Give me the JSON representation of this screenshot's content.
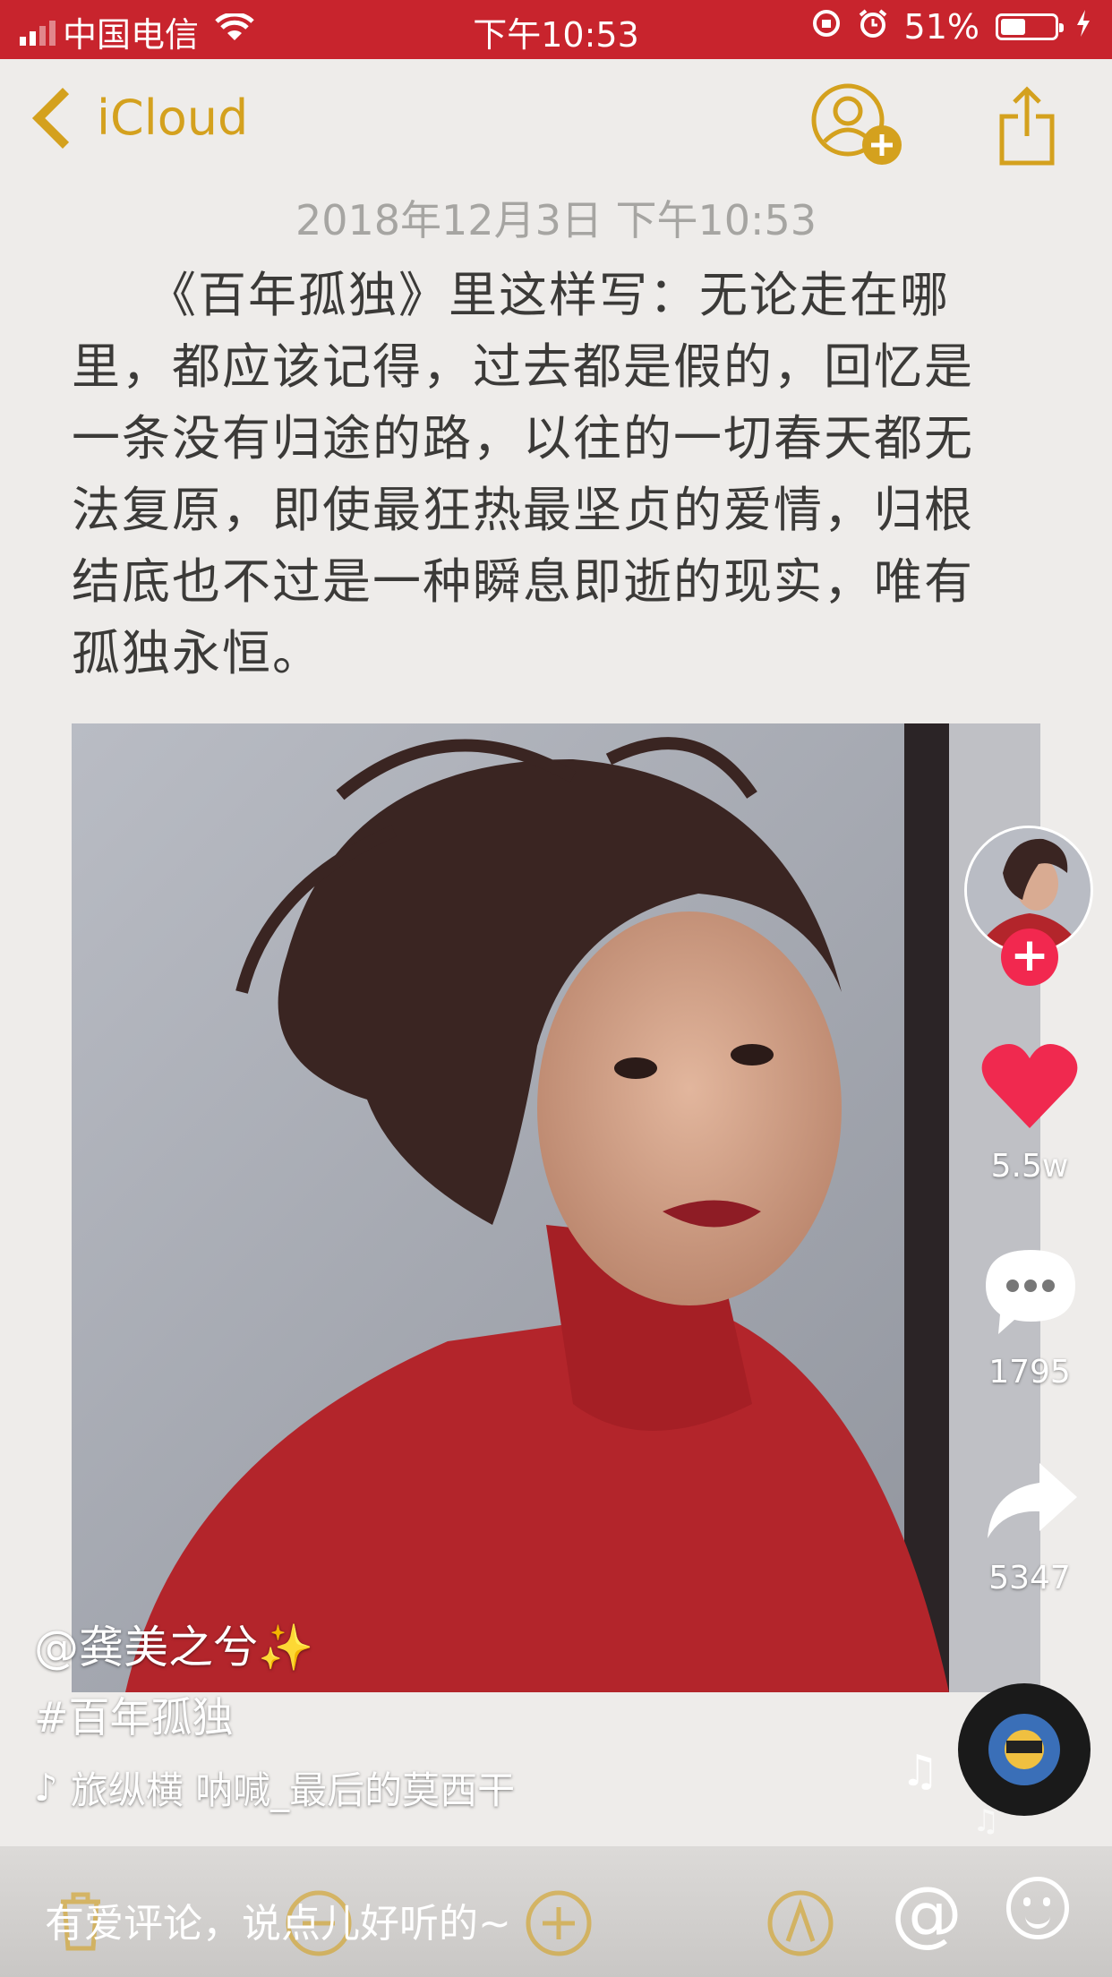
{
  "status_bar": {
    "carrier": "中国电信",
    "time": "下午10:53",
    "battery": "51%",
    "battery_level": 0.51,
    "color": "#c8242d"
  },
  "notes": {
    "back_label": "iCloud",
    "date": "2018年12月3日 下午10:53",
    "body": "　　《百年孤独》里这样写：无论走在哪里，都应该记得，过去都是假的，回忆是一条没有归途的路，以往的一切春天都无法复原，即使最狂热最坚贞的爱情，归根结底也不过是一种瞬息即逝的现实，唯有孤独永恒。",
    "accent_color": "#d4a11e"
  },
  "video": {
    "username": "@龚美之兮✨",
    "hashtag": "#百年孤独",
    "music": "旅纵横   呐喊_最后的莫西干",
    "likes": "5.5w",
    "comments": "1795",
    "shares": "5347",
    "follow_label": "+",
    "comment_placeholder": "有爱评论，说点儿好听的~",
    "at_label": "@"
  }
}
